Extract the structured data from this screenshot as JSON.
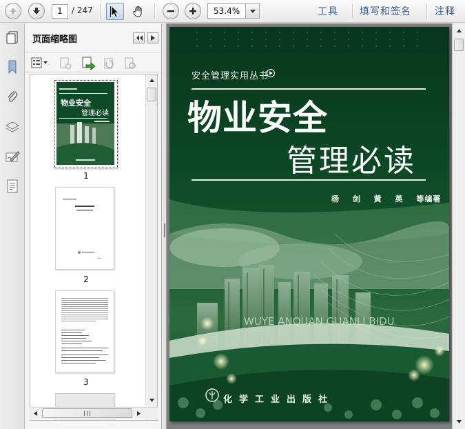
{
  "toolbar": {
    "page_current": "1",
    "page_total": "/ 247",
    "zoom_value": "53.4%",
    "menu_tools": "工具",
    "menu_fill_sign": "填写和签名",
    "menu_comment": "注释"
  },
  "thumbnail_panel": {
    "title": "页面缩略图",
    "pages": [
      {
        "label": "1"
      },
      {
        "label": "2"
      },
      {
        "label": "3"
      }
    ]
  },
  "document": {
    "series": "安全管理实用丛书",
    "title_line1": "物业安全",
    "title_line2": "管理必读",
    "authors": "杨 剑 黄 英 等编著",
    "pinyin": "WUYE ANQUAN GUANLI BIDU",
    "publisher": "化学工业出版社"
  },
  "colors": {
    "cover_green": "#0b3f22",
    "menu_blue": "#3a5e8f",
    "doc_background": "#7f7f7f"
  }
}
